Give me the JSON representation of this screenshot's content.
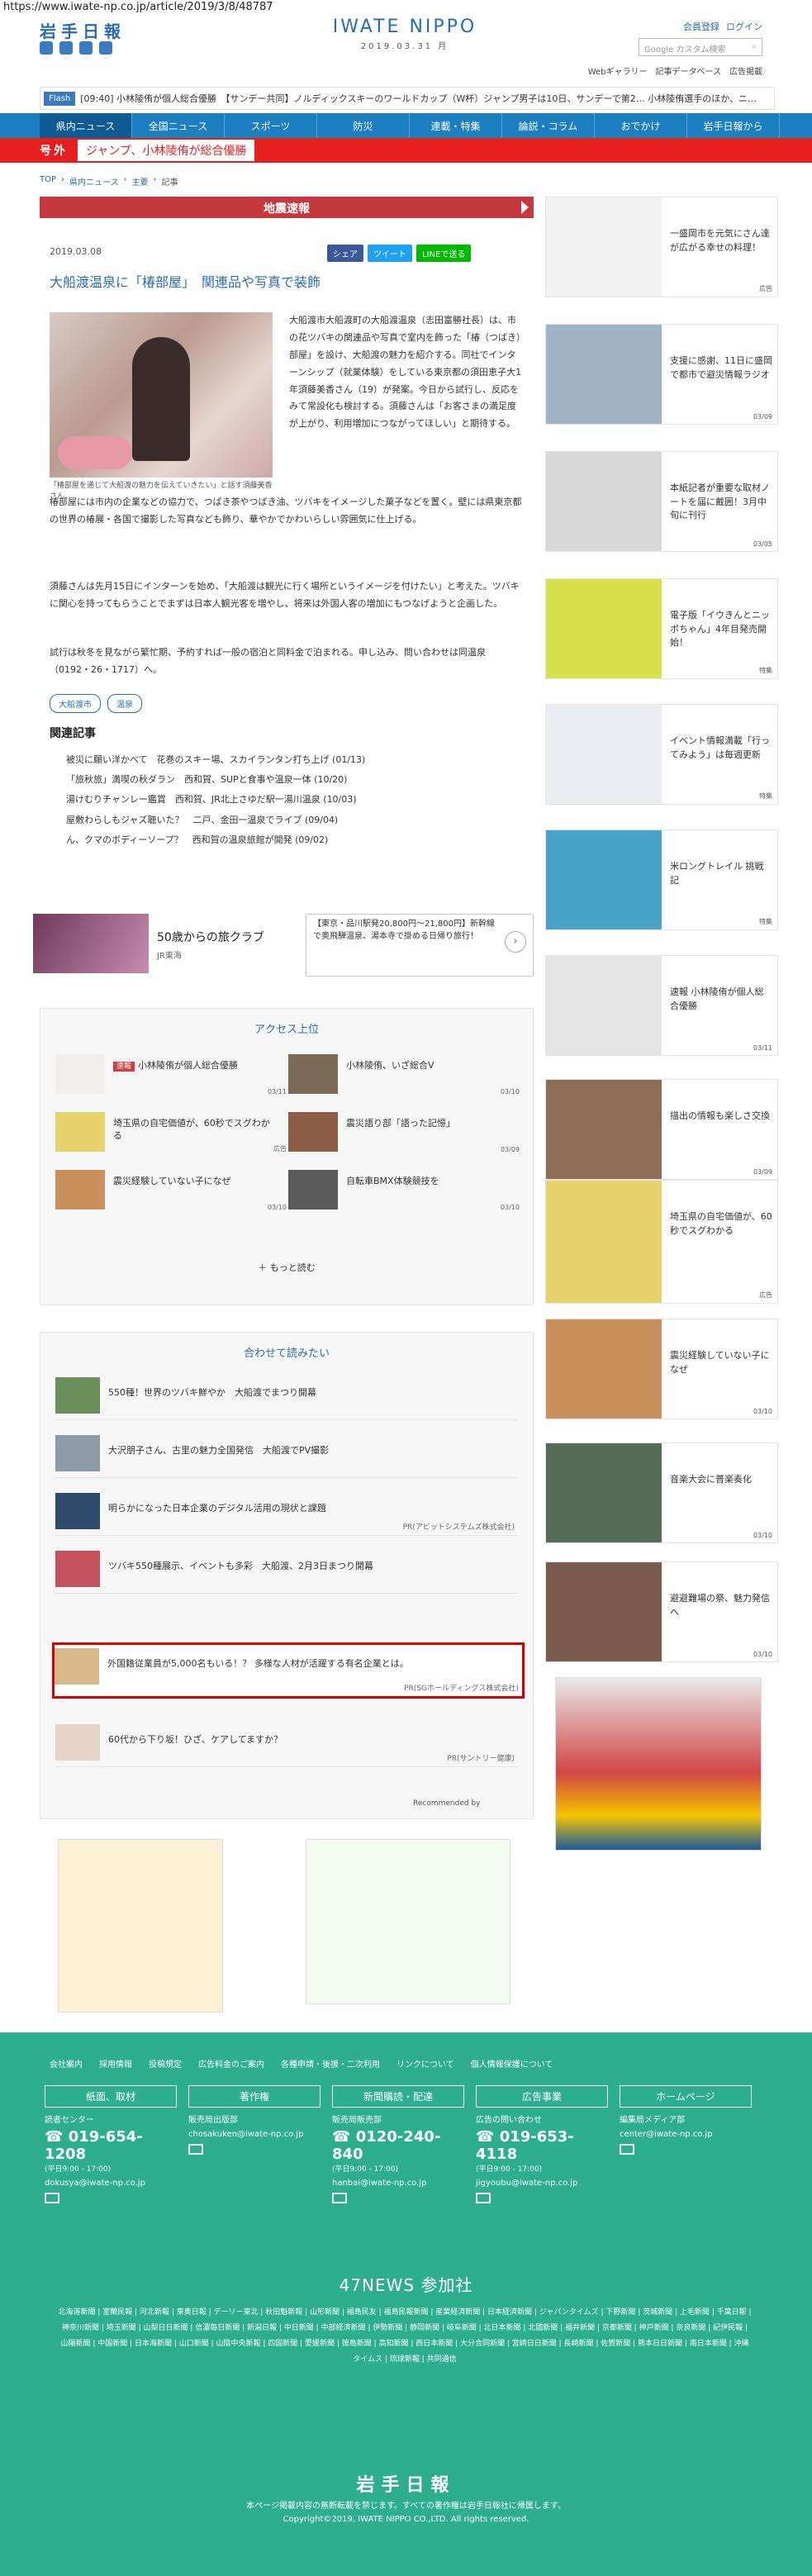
{
  "browser": {
    "url": "https://www.iwate-np.co.jp/article/2019/3/8/48787"
  },
  "header": {
    "logo": "岩手日報",
    "brand": "IWATE NIPPO",
    "date": "2019.03.31 月",
    "links": [
      "会員登録",
      "ログイン"
    ],
    "search_placeholder": "Google カスタム検索",
    "sublinks": [
      "Webギャラリー",
      "記事データベース",
      "広告掲載"
    ]
  },
  "ticker": {
    "badge": "Flash",
    "text": "[09:40] 小林陵侑が個人総合優勝　【サンデー共同】ノルディックスキーのワールドカップ（W杯）ジャンプ男子は10日、サンデーで第2… 小林陵侑選手のほか、ニ…"
  },
  "nav": {
    "items": [
      "県内ニュース",
      "全国ニュース",
      "スポーツ",
      "防災",
      "連載・特集",
      "論説・コラム",
      "おでかけ",
      "岩手日報から"
    ]
  },
  "gogai": {
    "label": "号外",
    "headline": "ジャンプ、小林陵侑が総合優勝"
  },
  "breadcrumb": [
    "TOP",
    "県内ニュース",
    "主要",
    "記事"
  ],
  "article": {
    "quake_bar": "地震速報",
    "date": "2019.03.08",
    "share": [
      "シェア",
      "ツイート",
      "LINEで送る"
    ],
    "title": "大船渡温泉に「椿部屋」　関連品や写真で装飾",
    "caption": "「椿部屋を通じて大船渡の魅力を伝えていきたい」と話す須藤美香さん",
    "para1": "大船渡市大船渡町の大船渡温泉（志田富勝社長）は、市の花ツバキの関連品や写真で室内を飾った「椿（つばき）部屋」を設け、大船渡の魅力を紹介する。同社でインターンシップ（就業体験）をしている東京都の須田恵子大1年須藤美香さん（19）が発案。今日から試行し、反応をみて常設化も検討する。須藤さんは「お客さまの満足度が上がり、利用増加につながってほしい」と期待する。",
    "para2": "椿部屋には市内の企業などの協力で、つばき茶やつばき油、ツバキをイメージした菓子などを置く。壁には県東京都の世界の椿展・各国で撮影した写真なども飾り、華やかでかわいらしい雰囲気に仕上げる。",
    "para3": "須藤さんは先月15日にインターンを始め、「大船渡は観光に行く場所というイメージを付けたい」と考えた。ツバキに関心を持ってもらうことでまずは日本人観光客を増やし、将来は外国人客の増加にもつなげようと企画した。",
    "para4": "試行は秋冬を見ながら繁忙期、予約すれば一般の宿泊と同料金で泊まれる。申し込み、問い合わせは同温泉（0192・26・1717）へ。",
    "tags": [
      "大船渡市",
      "温泉"
    ],
    "related_title": "関連記事",
    "related": [
      "被災に願い洋かべて　花巻のスキー場、スカイランタン打ち上げ (01/13)",
      "「旅秋旅」満喫の秋ダラン　西和賀、SUPと食事や温泉一体 (10/20)",
      "湯けむりチャンレー鑑賞　西和賀、JR北上さゆだ駅一湯川温泉 (10/03)",
      "屋敷わらしもジャズ聴いた？　二戸、金田一温泉でライブ (09/04)",
      "ん、クマのボディーソープ？　西和賀の温泉旅館が開発 (09/02)"
    ]
  },
  "ad_row": {
    "left_title": "50歳からの旅クラブ",
    "left_sub": "JR東海",
    "right_text": "【東京・品川駅発20,800円～21,800円】新幹線で奥飛騨温泉、湯本寺で掛める日帰り旅行！"
  },
  "access": {
    "title": "アクセス上位",
    "items": [
      {
        "badge": "速報",
        "text": "小林陵侑が個人総合優勝",
        "date": "03/11"
      },
      {
        "badge": "",
        "text": "小林陵侑、いざ総合V",
        "date": "03/10"
      },
      {
        "badge": "",
        "text": "埼玉県の自宅価値が、60秒でスグわかる",
        "date": "広告"
      },
      {
        "badge": "",
        "text": "震災語り部「語った記憶」",
        "date": "03/09"
      },
      {
        "badge": "",
        "text": "震災経験していない子になぜ",
        "date": "03/10"
      },
      {
        "badge": "",
        "text": "自転車BMX体験競技を",
        "date": "03/10"
      }
    ],
    "more": "もっと読む"
  },
  "read_more": {
    "title": "合わせて読みたい",
    "items": [
      {
        "text": "550種！世界のツバキ鮮やか　大船渡でまつり開幕",
        "pr": ""
      },
      {
        "text": "大沢朋子さん、古里の魅力全国発信　大船渡でPV撮影",
        "pr": ""
      },
      {
        "text": "明らかになった日本企業のデジタル活用の現状と課題",
        "pr": "PR(アビットシステムズ株式会社)"
      },
      {
        "text": "ツバキ550種展示、イベントも多彩　大船渡、2月3日まつり開幕",
        "pr": ""
      },
      {
        "text": "外国籍従業員が5,000名もいる！？ 多様な人材が活躍する有名企業とは。",
        "pr": "PR(SGホールディングス株式会社)"
      },
      {
        "text": "60代から下り坂！ひざ、ケアしてますか？",
        "pr": "PR(サントリー健康)"
      }
    ],
    "recommend": "Recommended by"
  },
  "sidebar": {
    "items": [
      {
        "text": "一盛岡市を元気にさん達が広がる幸せの料理！",
        "date": "広告"
      },
      {
        "text": "支援に感謝、11日に盛岡で都市で避災情報ラジオ",
        "date": "03/09"
      },
      {
        "text": "本紙記者が重要な取材ノートを届に戴囲！3月中旬に刊行",
        "date": "03/05"
      },
      {
        "text": "電子版「イウきんとニッポちゃん」4年目発売開始！",
        "date": "特集"
      },
      {
        "text": "イベント情報満載「行ってみよう」は毎週更新",
        "date": "特集"
      },
      {
        "text": "米ロングトレイル 挑戦記",
        "date": "特集"
      },
      {
        "text": "速報 小林陵侑が個人総合優勝",
        "date": "03/11"
      },
      {
        "text": "描出の情報も楽しさ交換",
        "date": "03/09"
      },
      {
        "text": "埼玉県の自宅価値が、60秒でスグわかる",
        "date": "広告"
      },
      {
        "text": "震災経験していない子になぜ",
        "date": "03/10"
      },
      {
        "text": "音楽大会に普楽奏化",
        "date": "03/10"
      },
      {
        "text": "避避難場の祭、魅力発信へ",
        "date": "03/10"
      }
    ]
  },
  "footer": {
    "links": [
      "会社案内",
      "採用情報",
      "投稿規定",
      "広告料金のご案内",
      "各種申請・後援・二次利用",
      "リンクについて",
      "個人情報保護について"
    ],
    "cols": [
      {
        "head": "紙面、取材",
        "sub": "読者センター",
        "tel": "019-654-1208",
        "hours": "(平日9:00 - 17:00)",
        "mail": "dokusya@iwate-np.co.jp"
      },
      {
        "head": "著作権",
        "sub": "販売局出版部",
        "tel": "",
        "hours": "",
        "mail": "chosakuken@iwate-np.co.jp"
      },
      {
        "head": "新聞購読・配達",
        "sub": "販売局販売部",
        "tel": "0120-240-840",
        "hours": "(平日9:00 - 17:00)",
        "mail": "hanbai@iwate-np.co.jp"
      },
      {
        "head": "広告事業",
        "sub": "広告の問い合わせ",
        "tel": "019-653-4118",
        "hours": "(平日9:00 - 17:00)",
        "mail": "jigyoubu@iwate-np.co.jp"
      },
      {
        "head": "ホームページ",
        "sub": "編集局メディア部",
        "tel": "",
        "hours": "",
        "mail": "center@iwate-np.co.jp"
      }
    ],
    "news47": "47NEWS 参加社",
    "papers": "北海道新聞 | 室蘭民報 | 河北新報 | 東奥日報 | デーリー東北 | 秋田魁新報 | 山形新聞 | 福島民友 | 福島民報新聞 | 産業経済新聞 | 日本経済新聞 | ジャパンタイムズ | 下野新聞 | 茨城新聞 | 上毛新聞 | 千葉日報 | 神奈川新聞 | 埼玉新聞 | 山梨日日新聞 | 信濃毎日新聞 | 新潟日報 | 中日新聞 | 中部経済新聞 | 伊勢新聞 | 静岡新聞 | 岐阜新聞 | 北日本新聞 | 北國新聞 | 福井新聞 | 京都新聞 | 神戸新聞 | 奈良新聞 | 紀伊民報 | 山陽新聞 | 中国新聞 | 日本海新聞 | 山口新聞 | 山陰中央新報 | 四国新聞 | 愛媛新聞 | 徳島新聞 | 高知新聞 | 西日本新聞 | 大分合同新聞 | 宮崎日日新聞 | 長崎新聞 | 佐賀新聞 | 熊本日日新聞 | 南日本新聞 | 沖縄タイムス | 琉球新報 | 共同通信",
    "logo": "岩手日報",
    "copy1": "本ページ掲載内容の無断転載を禁じます。すべての著作権は岩手日報社に帰属します。",
    "copy2": "Copyright©2019, IWATE NIPPO CO.,LTD. All rights reserved."
  }
}
